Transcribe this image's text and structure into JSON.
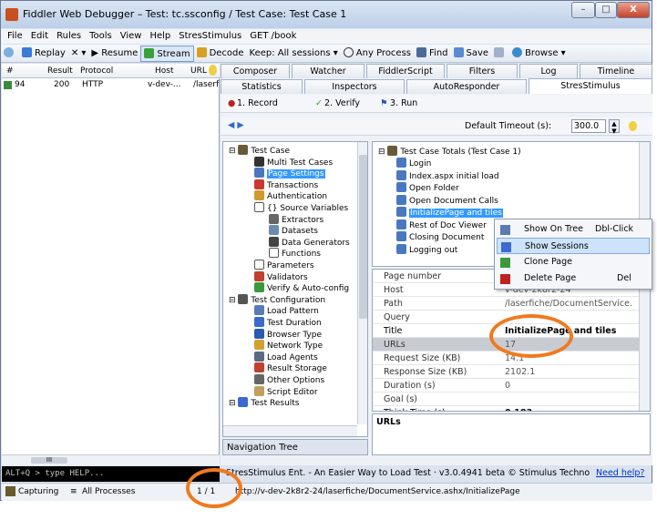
{
  "window": {
    "title": "Fiddler Web Debugger – Test: tc.ssconfig / Test Case: Test Case 1",
    "min": "–",
    "max": "□",
    "close": "X"
  },
  "menu": [
    "File",
    "Edit",
    "Rules",
    "Tools",
    "View",
    "Help",
    "StresStimulus",
    "GET /book"
  ],
  "toolbar": {
    "replay": "Replay",
    "x": "✕ ▾",
    "resume": "▶ Resume",
    "stream": "Stream",
    "decode": "Decode",
    "keep": "Keep: All sessions ▾",
    "process": "Any Process",
    "find": "Find",
    "save": "Save",
    "browse": "Browse ▾"
  },
  "sessions": {
    "cols": [
      "#",
      "Result",
      "Protocol",
      "Host",
      "URL"
    ],
    "row": {
      "num": "94",
      "result": "200",
      "protocol": "HTTP",
      "host": "v-dev-...",
      "url": "/laserf"
    }
  },
  "quickexec": "ALT+Q > type HELP...",
  "status": {
    "capturing": "Capturing",
    "processes": "All Processes",
    "count": "1 / 1",
    "url": "http://v-dev-2k8r2-24/laserfiche/DocumentService.ashx/InitializePage"
  },
  "tabs_top": [
    "Composer",
    "Watcher",
    "FiddlerScript",
    "Filters",
    "Log",
    "Timeline"
  ],
  "tabs_bottom": [
    "Statistics",
    "Inspectors",
    "AutoResponder",
    "StresStimulus"
  ],
  "ss": {
    "record": "1. Record",
    "verify": "2. Verify",
    "run": "3. Run",
    "timeout_label": "Default Timeout (s):",
    "timeout_value": "300.0"
  },
  "tree": [
    {
      "t": "Test Case",
      "lvl": 0,
      "c": "#6b5a3a"
    },
    {
      "t": "Multi Test Cases",
      "lvl": 1,
      "c": "#333"
    },
    {
      "t": "Page Settings",
      "lvl": 1,
      "c": "#4a78c0",
      "sel": true
    },
    {
      "t": "Transactions",
      "lvl": 1,
      "c": "#c83a2e"
    },
    {
      "t": "Authentication",
      "lvl": 1,
      "c": "#d09a2c"
    },
    {
      "t": "{} Source Variables",
      "lvl": 1,
      "c": "#fff"
    },
    {
      "t": "Extractors",
      "lvl": 2,
      "c": "#666"
    },
    {
      "t": "Datasets",
      "lvl": 2,
      "c": "#6a8ab0"
    },
    {
      "t": "Data Generators",
      "lvl": 2,
      "c": "#444"
    },
    {
      "t": "Functions",
      "lvl": 2,
      "c": "#fff"
    },
    {
      "t": "Parameters",
      "lvl": 1,
      "c": "#fff"
    },
    {
      "t": "Validators",
      "lvl": 1,
      "c": "#c04030"
    },
    {
      "t": "Verify & Auto-config",
      "lvl": 1,
      "c": "#3a9a3a"
    },
    {
      "t": "Test Configuration",
      "lvl": 0,
      "c": "#555"
    },
    {
      "t": "Load Pattern",
      "lvl": 1,
      "c": "#5a7ab8"
    },
    {
      "t": "Test Duration",
      "lvl": 1,
      "c": "#3a6ad0"
    },
    {
      "t": "Browser Type",
      "lvl": 1,
      "c": "#2a5ab0"
    },
    {
      "t": "Network Type",
      "lvl": 1,
      "c": "#d0a030"
    },
    {
      "t": "Load Agents",
      "lvl": 1,
      "c": "#5a6a80"
    },
    {
      "t": "Result Storage",
      "lvl": 1,
      "c": "#c04030"
    },
    {
      "t": "Other Options",
      "lvl": 1,
      "c": "#666"
    },
    {
      "t": "Script Editor",
      "lvl": 1,
      "c": "#c0a060"
    },
    {
      "t": "Test Results",
      "lvl": 0,
      "c": "#3a6ad0"
    }
  ],
  "navtree": "Navigation Tree",
  "totals": {
    "root": "Test Case Totals (Test Case 1)",
    "items": [
      "Login",
      "Index.aspx initial load",
      "Open Folder",
      "Open Document Calls",
      "InitializePage and tiles",
      "Rest of Doc Viewer",
      "Closing Document",
      "Logging out"
    ]
  },
  "props": [
    {
      "k": "Page number",
      "v": "5"
    },
    {
      "k": "Host",
      "v": "v-dev-2k8r2-24"
    },
    {
      "k": "Path",
      "v": "/laserfiche/DocumentService."
    },
    {
      "k": "Query",
      "v": ""
    },
    {
      "k": "Title",
      "v": "InitializePage and tiles"
    },
    {
      "k": "URLs",
      "v": "17"
    },
    {
      "k": "Request Size (KB)",
      "v": "14.1"
    },
    {
      "k": "Response Size (KB)",
      "v": "2102.1"
    },
    {
      "k": "Duration (s)",
      "v": "0"
    },
    {
      "k": "Goal (s)",
      "v": ""
    },
    {
      "k": "Think Time (s)",
      "v": "0.183"
    }
  ],
  "urls_label": "URLs",
  "banner": {
    "text": "StresStimulus Ent. - An Easier Way to Load Test · v3.0.4941 beta © Stimulus Technol",
    "link": "Need help?"
  },
  "context": [
    {
      "label": "Show On Tree",
      "shortcut": "Dbl-Click"
    },
    {
      "label": "Show Sessions",
      "shortcut": ""
    },
    {
      "label": "Clone Page",
      "shortcut": ""
    },
    {
      "label": "Delete Page",
      "shortcut": "Del"
    }
  ],
  "colors": {
    "ring": "#f07a1e",
    "selection": "#3399ff"
  }
}
